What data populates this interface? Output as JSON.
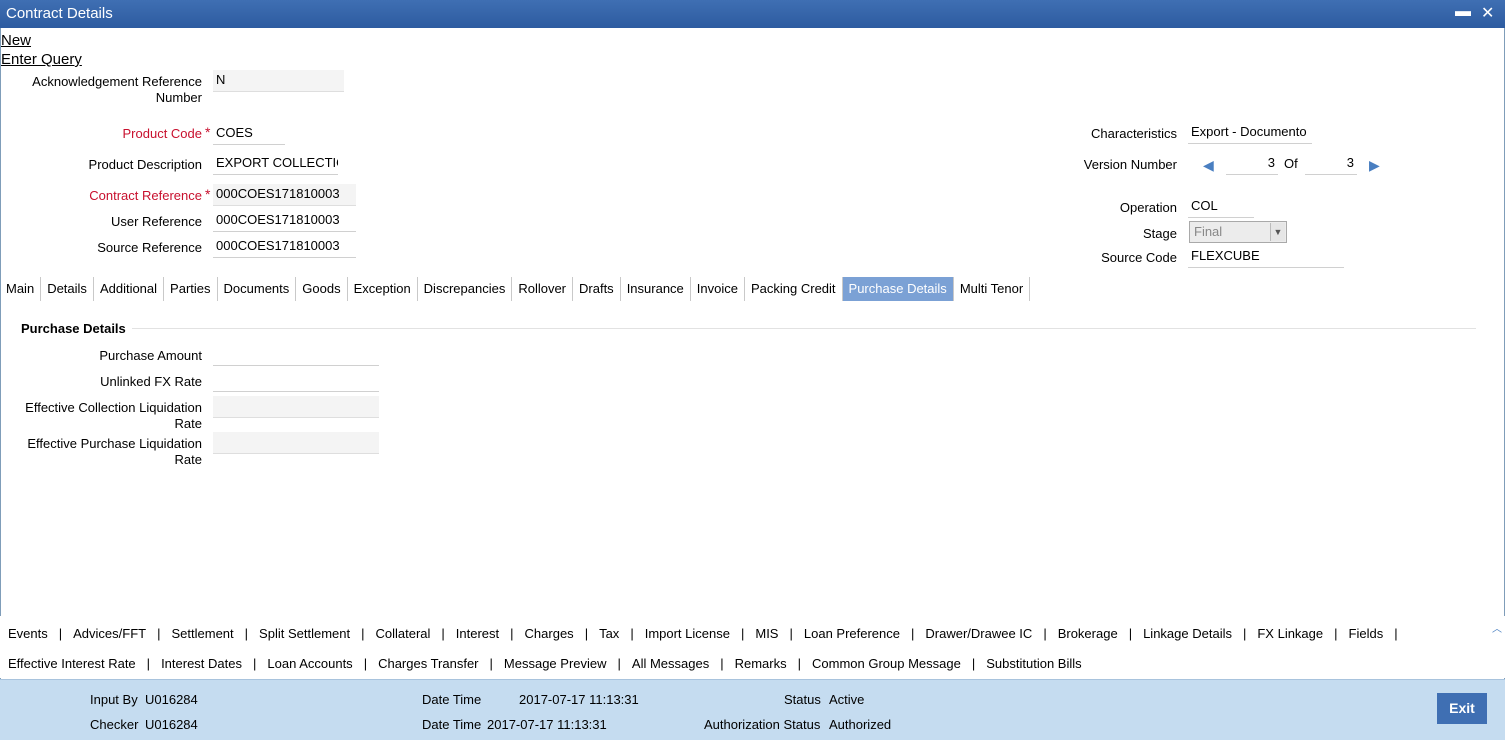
{
  "window": {
    "title": "Contract Details",
    "minimize": "▬",
    "close": "✕"
  },
  "actions": {
    "new": "New",
    "enter_query": "Enter Query"
  },
  "header": {
    "ack_ref_label_line1": "Acknowledgement Reference",
    "ack_ref_label_line2": "Number",
    "ack_ref_value": "N",
    "product_code_label": "Product Code",
    "product_code_value": "COES",
    "product_desc_label": "Product Description",
    "product_desc_value": "EXPORT COLLECTIO",
    "contract_ref_label": "Contract Reference",
    "contract_ref_value": "000COES171810003",
    "user_ref_label": "User Reference",
    "user_ref_value": "000COES171810003",
    "source_ref_label": "Source Reference",
    "source_ref_value": "000COES171810003",
    "required_marker": "*",
    "characteristics_label": "Characteristics",
    "characteristics_value": "Export  - Documento",
    "version_label": "Version Number",
    "version_current": "3",
    "version_of": "Of",
    "version_total": "3",
    "operation_label": "Operation",
    "operation_value": "COL",
    "stage_label": "Stage",
    "stage_value": "Final",
    "source_code_label": "Source Code",
    "source_code_value": "FLEXCUBE"
  },
  "tabs": [
    "Main",
    "Details",
    "Additional",
    "Parties",
    "Documents",
    "Goods",
    "Exception",
    "Discrepancies",
    "Rollover",
    "Drafts",
    "Insurance",
    "Invoice",
    "Packing Credit",
    "Purchase Details",
    "Multi Tenor"
  ],
  "active_tab": "Purchase Details",
  "purchase": {
    "section_title": "Purchase Details",
    "amount_label": "Purchase Amount",
    "amount_value": "",
    "unlinked_fx_label": "Unlinked FX Rate",
    "unlinked_fx_value": "",
    "eff_coll_label_line1": "Effective Collection Liquidation",
    "eff_coll_label_line2": "Rate",
    "eff_coll_value": "",
    "eff_purch_label_line1": "Effective Purchase Liquidation",
    "eff_purch_label_line2": "Rate",
    "eff_purch_value": ""
  },
  "sublinks_row1": [
    "Events",
    "Advices/FFT",
    "Settlement",
    "Split Settlement",
    "Collateral",
    "Interest",
    "Charges",
    "Tax",
    "Import License",
    "MIS",
    "Loan Preference",
    "Drawer/Drawee IC",
    "Brokerage",
    "Linkage Details",
    "FX Linkage",
    "Fields"
  ],
  "sublinks_row2": [
    "Effective Interest Rate",
    "Interest Dates",
    "Loan Accounts",
    "Charges Transfer",
    "Message Preview",
    "All Messages",
    "Remarks",
    "Common Group Message",
    "Substitution Bills"
  ],
  "separator": "|",
  "footer": {
    "input_by_label": "Input By",
    "input_by_value": "U016284",
    "checker_label": "Checker",
    "checker_value": "U016284",
    "datetime_label": "Date Time",
    "datetime1_value": "2017-07-17 11:13:31",
    "datetime2_value": "2017-07-17 11:13:31",
    "status_label": "Status",
    "status_value": "Active",
    "auth_status_label": "Authorization Status",
    "auth_status_value": "Authorized",
    "exit_label": "Exit"
  },
  "icons": {
    "prev": "triangle-left-icon",
    "next": "triangle-right-icon",
    "dropdown": "chevron-down-icon",
    "scroll_up": "chevron-up-icon"
  },
  "colors": {
    "title_bar": "#3f6fb3",
    "active_tab": "#7ba1d5",
    "required": "#c8102e",
    "footer": "#c5dcf0"
  }
}
